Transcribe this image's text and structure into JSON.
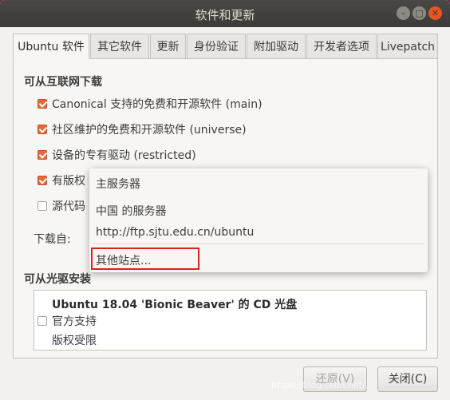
{
  "window": {
    "title": "软件和更新"
  },
  "tabs": [
    {
      "label": "Ubuntu 软件"
    },
    {
      "label": "其它软件"
    },
    {
      "label": "更新"
    },
    {
      "label": "身份验证"
    },
    {
      "label": "附加驱动"
    },
    {
      "label": "开发者选项"
    },
    {
      "label": "Livepatch"
    }
  ],
  "internet_section": {
    "title": "可从互联网下载",
    "items": [
      {
        "label": "Canonical 支持的免费和开源软件 (main)",
        "checked": true
      },
      {
        "label": "社区维护的免费和开源软件 (universe)",
        "checked": true
      },
      {
        "label": "设备的专有驱动 (restricted)",
        "checked": true
      },
      {
        "label": "有版权",
        "checked": true
      },
      {
        "label": "源代码",
        "checked": false
      }
    ],
    "download_from_label": "下载自:"
  },
  "server_menu": {
    "items": [
      {
        "label": "主服务器"
      },
      {
        "label": "中国 的服务器"
      },
      {
        "label": "http://ftp.sjtu.edu.cn/ubuntu"
      },
      {
        "label": "其他站点..."
      }
    ]
  },
  "cdrom_section": {
    "title": "可从光驱安装",
    "cd_title": "Ubuntu 18.04 'Bionic Beaver' 的 CD 光盘",
    "cd_line1": "官方支持",
    "cd_line2": "版权受限",
    "checked": false
  },
  "buttons": {
    "revert": "还原(V)",
    "close": "关闭(C)"
  },
  "watermark": "https://blog.csdn.net/..."
}
